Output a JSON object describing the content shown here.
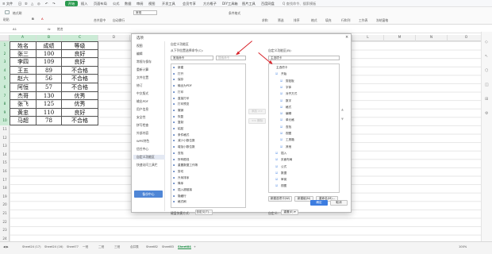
{
  "menubar": {
    "items": [
      "≡ 文件",
      "日",
      "⑤",
      "△",
      "◎",
      "↶",
      "↷",
      "开始",
      "插入",
      "页面布局",
      "公式",
      "数据",
      "审阅",
      "视图",
      "开发工具",
      "会员专享",
      "方方格子",
      "DIY工具箱",
      "图片工具",
      "百度网盘",
      "Q 查找命令、搜索模板"
    ],
    "start_label": "开始"
  },
  "ribbon": {
    "items": [
      "格式刷",
      "粘贴",
      "B",
      "A",
      "合并居中",
      "自动换行",
      "常规",
      "条件格式",
      "求和",
      "筛选",
      "排序",
      "格式",
      "填充",
      "行和列",
      "工作表",
      "冻结窗格"
    ]
  },
  "formulabar": {
    "cell_ref": "A1",
    "fx": "fx",
    "value": "姓名"
  },
  "columns": [
    "A",
    "B",
    "C",
    "D",
    "E",
    "F",
    "G",
    "H",
    "I",
    "J",
    "K",
    "L",
    "M",
    "N",
    "O"
  ],
  "rows": [
    "1",
    "2",
    "3",
    "4",
    "5",
    "6",
    "7",
    "8",
    "9",
    "10",
    "11",
    "12",
    "13",
    "14",
    "15",
    "16",
    "17",
    "18",
    "19",
    "20",
    "21",
    "22",
    "23",
    "24"
  ],
  "table": {
    "headers": [
      "姓名",
      "成绩",
      "等级"
    ],
    "data": [
      [
        "张三",
        "100",
        "良好"
      ],
      [
        "李四",
        "109",
        "良好"
      ],
      [
        "王五",
        "89",
        "不合格"
      ],
      [
        "赵六",
        "56",
        "不合格"
      ],
      [
        "阿恒",
        "57",
        "不合格"
      ],
      [
        "杰哥",
        "130",
        "优秀"
      ],
      [
        "张飞",
        "125",
        "优秀"
      ],
      [
        "黄忠",
        "110",
        "良好"
      ],
      [
        "马超",
        "78",
        "不合格"
      ]
    ]
  },
  "dialog": {
    "title": "选项",
    "nav": [
      "视图",
      "编辑",
      "常规与保存",
      "重新计算",
      "文件位置",
      "修订",
      "中文版式",
      "输出PDF",
      "用户信息",
      "安全性",
      "拼写检查",
      "外部内容",
      "WPS特色",
      "信任中心",
      "自定义功能区",
      "快速访问工具栏"
    ],
    "active_nav": "自定义功能区",
    "backup_label": "备份中心",
    "left_caption": "自定义功能区",
    "from_label": "从下列位置选择命令(C):",
    "from_value": "常用命令",
    "search_placeholder": "搜索命令",
    "commands": [
      "新建",
      "打开",
      "保存",
      "输出为PDF",
      "打印",
      "直接打印",
      "打印预览",
      "撤销",
      "恢复",
      "复制",
      "粘贴",
      "条件格式",
      "减少小数位数",
      "增加小数位数",
      "查找",
      "所有框线",
      "重置数据工作簿",
      "剪切",
      "升序排序",
      "降序",
      "插入超链接",
      "隐藏行",
      "格式刷"
    ],
    "right_label": "自定义功能区(B):",
    "right_value": "主选项卡",
    "tree": [
      "主选项卡",
      "开始",
      "剪贴板",
      "字体",
      "对齐方式",
      "数字",
      "格式",
      "编辑",
      "单元格",
      "查找",
      "视图",
      "工具箱",
      "其他",
      "插入",
      "页面布局",
      "公式",
      "数据",
      "审阅",
      "视图"
    ],
    "add_label": "添加 >>",
    "remove_label": "<< 删除",
    "new_tab_label": "新建选项卡(W)",
    "new_group_label": "新建组(N)",
    "rename_label": "重命名(M)...",
    "keyboard_label": "键盘快捷方式:",
    "customize_label": "自定义(T)...",
    "custom_label": "自定义:",
    "reset_label": "重置(E) ▾",
    "ok_label": "确定",
    "cancel_label": "取消"
  },
  "sheets": [
    "Sheet24 (17)",
    "Sheet24 (16)",
    "Sheet77",
    "一班",
    "二班",
    "三班",
    "合并表",
    "Sheet82",
    "Sheet83",
    "Sheet84",
    "+"
  ],
  "active_sheet": "Sheet84",
  "statusbar": {
    "zoom": "100%"
  }
}
